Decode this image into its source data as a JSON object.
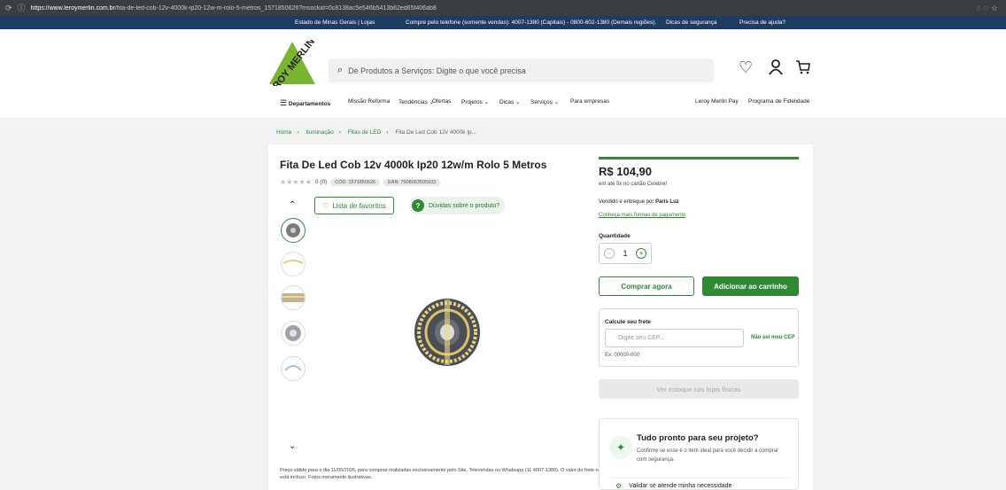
{
  "browser": {
    "url_host": "https://www.leroymerlin.com.br",
    "url_path": "/fita-de-led-cob-12v-4000k-ip20-12w-m-rolo-5-metros_1571850626?msockid=0c8138ac5e546b5413b62ed65f406ab8"
  },
  "topbar": {
    "location": "Estado de Minas Gerais  |  Lojas",
    "phone": "Compre pelo telefone (somente vendas): 4007-1380 (Capitais) - 0800-602-1380 (Demais regiões).",
    "security": "Dicas de segurança",
    "help": "Precisa de ajuda?"
  },
  "header": {
    "logo_text": "LEROY MERLIN",
    "search_placeholder": "De Produtos a Serviços: Digite o que você precisa"
  },
  "nav": {
    "departments": "Departamentos",
    "items": [
      "Missão Reforma",
      "Tendências ⌄",
      "Ofertas",
      "Projetos ⌄",
      "Dicas ⌄",
      "Serviços ⌄",
      "Para empresas"
    ],
    "pay": "Leroy Merlin Pay",
    "loyalty": "Programa de Fidelidade"
  },
  "breadcrumb": {
    "items": [
      "Home",
      "Iluminação",
      "Fitas de LED",
      "Fita De Led Cob 12v 4000k Ip..."
    ]
  },
  "product": {
    "title": "Fita De Led Cob 12v 4000k Ip20 12w/m Rolo 5 Metros",
    "rating": "0 (0)",
    "code": "CÓD. 1571850626",
    "ean": "EAN: 7908063505933",
    "favorites_label": "Lista de favoritos",
    "doubts_label": "Dúvidas sobre o produto?",
    "disclaimer": "Preço válido para o dia 11/05/2026, para compras realizadas exclusivamente pelo Site, Televendas ou Whatsapp (11 4007-1380). O valor do frete não está incluso. Fotos meramente ilustrativas."
  },
  "purchase": {
    "price": "R$ 104,90",
    "installments": "em até 5x no cartão Celebre!",
    "seller_prefix": "Vendido e entregue por ",
    "seller_name": "Paris Luz",
    "payment_link": "Conheça mais formas de pagamento",
    "quantity_label": "Quantidade",
    "quantity_value": "1",
    "buy_now": "Comprar agora",
    "add_to_cart": "Adicionar ao carrinho",
    "freight_title": "Calcule seu frete",
    "cep_placeholder": "Digite seu CEP...",
    "cep_link": "Não sei meu CEP",
    "cep_example": "Ex: 00000-000",
    "stock_button": "Ver estoque nas lojas físicas"
  },
  "ready": {
    "title": "Tudo pronto para seu projeto?",
    "text": "Confirme se esse é o item ideal para você decidir a comprar com segurança.",
    "validate": "Validar se atende minha necessidade"
  },
  "colors": {
    "brand_green": "#2f8a33",
    "topbar_navy": "#1d3b63"
  }
}
